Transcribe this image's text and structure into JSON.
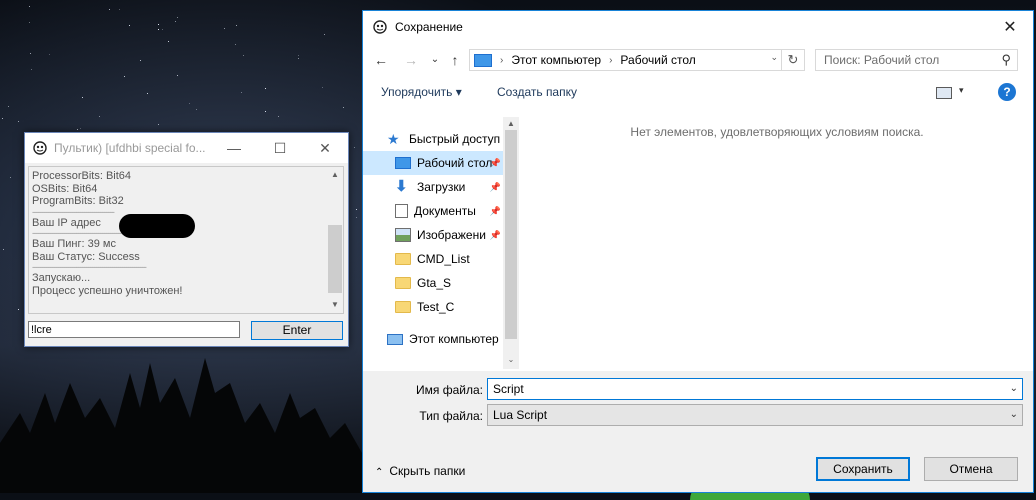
{
  "background": {
    "scene": "night sky with stars and tree silhouettes"
  },
  "mini_window": {
    "title": "Пультик) [ufdhbi special fo...",
    "controls": {
      "minimize": "—",
      "maximize": "☐",
      "close": "✕"
    },
    "output_lines": [
      {
        "kind": "text",
        "text": "ProcessorBits: Bit64"
      },
      {
        "kind": "text",
        "text": "OSBits: Bit64"
      },
      {
        "kind": "text",
        "text": "ProgramBits: Bit32"
      },
      {
        "kind": "sep",
        "text": "-----------------------------------------"
      },
      {
        "kind": "text",
        "text": "Ваш IP адрес"
      },
      {
        "kind": "sep",
        "text": "---------------------------------------------------------"
      },
      {
        "kind": "text",
        "text": "Ваш Пинг: 39 мс"
      },
      {
        "kind": "text",
        "text": "Ваш Статус: Success"
      },
      {
        "kind": "sep",
        "text": "---------------------------------------------------------"
      },
      {
        "kind": "text",
        "text": "Запускаю..."
      },
      {
        "kind": "text",
        "text": "Процесс успешно уничтожен!"
      }
    ],
    "command_value": "!lcre",
    "enter_label": "Enter"
  },
  "dialog": {
    "title": "Сохранение",
    "close": "✕",
    "nav": {
      "back": "←",
      "forward": "→",
      "recent": "⌄",
      "up": "↑"
    },
    "address": {
      "segments": [
        "Этот компьютер",
        "Рабочий стол"
      ],
      "separator": "›",
      "dropdown": "⌄",
      "refresh": "↻"
    },
    "search_placeholder": "Поиск: Рабочий стол",
    "search_icon": "⚲",
    "toolbar": {
      "organize": "Упорядочить ▾",
      "new_folder": "Создать папку",
      "view_dropdown": "▾",
      "help": "?"
    },
    "nav_items": [
      {
        "label": "Быстрый доступ",
        "icon": "star-icon",
        "pinned": false,
        "selected": false
      },
      {
        "label": "Рабочий стол",
        "icon": "desktop-icon",
        "pinned": true,
        "selected": true
      },
      {
        "label": "Загрузки",
        "icon": "download-icon",
        "pinned": true,
        "selected": false
      },
      {
        "label": "Документы",
        "icon": "documents-icon",
        "pinned": true,
        "selected": false
      },
      {
        "label": "Изображени",
        "icon": "pictures-icon",
        "pinned": true,
        "selected": false
      },
      {
        "label": "CMD_List",
        "icon": "folder-icon",
        "pinned": false,
        "selected": false
      },
      {
        "label": "Gta_S",
        "icon": "folder-icon",
        "pinned": false,
        "selected": false
      },
      {
        "label": "Test_C",
        "icon": "folder-icon",
        "pinned": false,
        "selected": false
      },
      {
        "label": "Этот компьютер",
        "icon": "computer-icon",
        "pinned": false,
        "selected": false
      }
    ],
    "pin_glyph": "📌",
    "empty_message": "Нет элементов, удовлетворяющих условиям поиска.",
    "file_name_label": "Имя файла:",
    "file_name_value": "Script",
    "file_type_label": "Тип файла:",
    "file_type_value": "Lua Script",
    "field_dropdown": "⌄",
    "hide_folders": "Скрыть папки",
    "hide_chevron": "⌃",
    "save_label": "Сохранить",
    "cancel_label": "Отмена"
  },
  "colors": {
    "accent": "#0078d7",
    "selection": "#cce8ff",
    "folder": "#f8d775"
  }
}
